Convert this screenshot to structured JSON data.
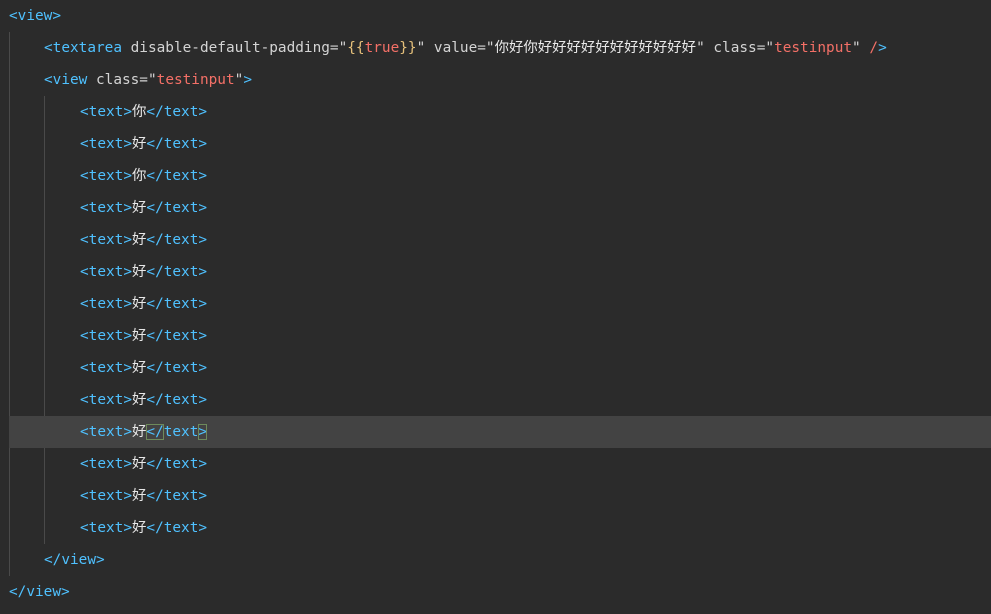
{
  "lines": [
    {
      "id": "l1",
      "parts": [
        {
          "c": "punc",
          "t": "<"
        },
        {
          "c": "tag",
          "t": "view"
        },
        {
          "c": "punc",
          "t": ">"
        }
      ]
    },
    {
      "id": "l2",
      "parts": [
        {
          "c": "punc",
          "t": "<"
        },
        {
          "c": "tag",
          "t": "textarea"
        },
        {
          "c": "attr",
          "t": " disable-default-padding="
        },
        {
          "c": "plain",
          "t": "\""
        },
        {
          "c": "brace",
          "t": "{{"
        },
        {
          "c": "kw",
          "t": "true"
        },
        {
          "c": "brace",
          "t": "}}"
        },
        {
          "c": "plain",
          "t": "\""
        },
        {
          "c": "attr",
          "t": " value="
        },
        {
          "c": "plain",
          "t": "\""
        },
        {
          "c": "str",
          "t": "你好你好好好好好好好好好好好"
        },
        {
          "c": "plain",
          "t": "\""
        },
        {
          "c": "attr",
          "t": " class="
        },
        {
          "c": "plain",
          "t": "\""
        },
        {
          "c": "str",
          "t": "testinput"
        },
        {
          "c": "plain",
          "t": "\""
        },
        {
          "c": "plain",
          "t": " "
        },
        {
          "c": "kw",
          "t": "/"
        },
        {
          "c": "punc",
          "t": ">"
        }
      ]
    },
    {
      "id": "l3",
      "parts": [
        {
          "c": "punc",
          "t": "<"
        },
        {
          "c": "tag",
          "t": "view"
        },
        {
          "c": "attr",
          "t": " class="
        },
        {
          "c": "plain",
          "t": "\""
        },
        {
          "c": "str",
          "t": "testinput"
        },
        {
          "c": "plain",
          "t": "\""
        },
        {
          "c": "punc",
          "t": ">"
        }
      ]
    },
    {
      "id": "t1",
      "char": "你"
    },
    {
      "id": "t2",
      "char": "好"
    },
    {
      "id": "t3",
      "char": "你"
    },
    {
      "id": "t4",
      "char": "好"
    },
    {
      "id": "t5",
      "char": "好"
    },
    {
      "id": "t6",
      "char": "好"
    },
    {
      "id": "t7",
      "char": "好"
    },
    {
      "id": "t8",
      "char": "好"
    },
    {
      "id": "t9",
      "char": "好"
    },
    {
      "id": "t10",
      "char": "好"
    },
    {
      "id": "t11",
      "char": "好",
      "active": true
    },
    {
      "id": "t12",
      "char": "好"
    },
    {
      "id": "t13",
      "char": "好"
    },
    {
      "id": "t14",
      "char": "好"
    },
    {
      "id": "l18",
      "parts": [
        {
          "c": "punc",
          "t": "</"
        },
        {
          "c": "tag",
          "t": "view"
        },
        {
          "c": "punc",
          "t": ">"
        }
      ]
    },
    {
      "id": "l19",
      "parts": [
        {
          "c": "punc",
          "t": "</"
        },
        {
          "c": "tag",
          "t": "view"
        },
        {
          "c": "punc",
          "t": ">"
        }
      ]
    }
  ],
  "text_tag": {
    "open_lt": "<",
    "name": "text",
    "gt": ">",
    "close_lt": "</"
  },
  "colors": {
    "background": "#2b2b2b",
    "active_line": "#434343",
    "tag": "#4fc1ff",
    "string": "#f47067",
    "brace": "#e5c07b",
    "plain": "#d4d4d4",
    "bracket_match": "#6e8a5b"
  }
}
